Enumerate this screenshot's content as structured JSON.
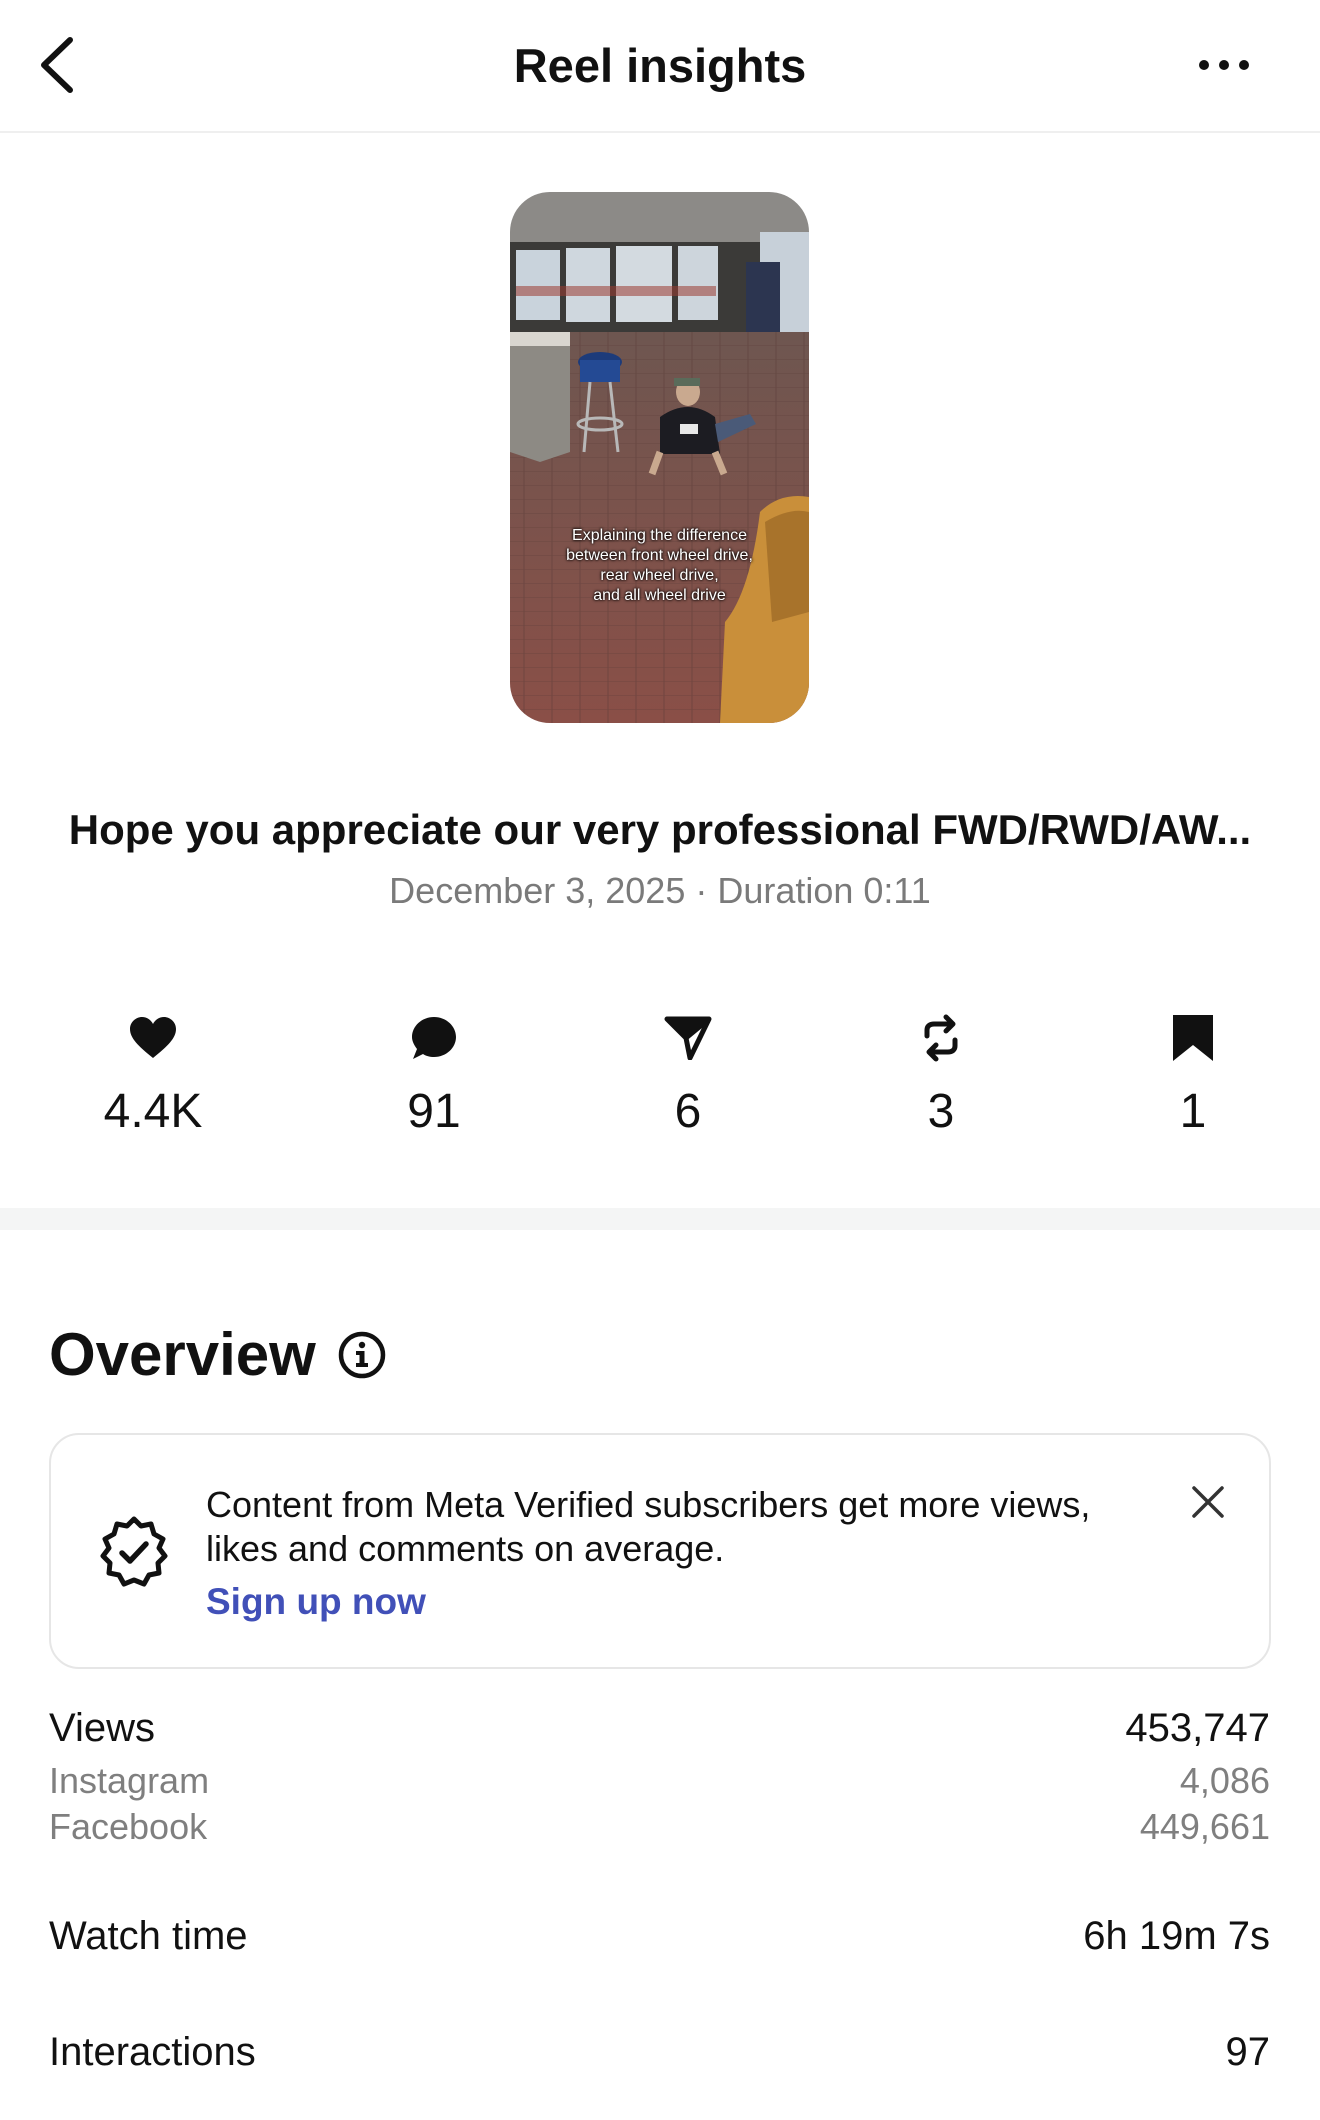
{
  "header": {
    "title": "Reel insights",
    "back_icon": "chevron-left-icon",
    "more_icon": "more-horizontal-icon"
  },
  "reel": {
    "thumbnail_caption": [
      "Explaining the difference",
      "between front wheel drive,",
      "rear wheel drive,",
      "and all wheel drive"
    ],
    "title": "Hope you appreciate our very professional FWD/RWD/AW...",
    "meta": "December 3, 2025 · Duration 0:11"
  },
  "stats": [
    {
      "icon": "heart-icon",
      "value": "4.4K"
    },
    {
      "icon": "comment-icon",
      "value": "91"
    },
    {
      "icon": "share-icon",
      "value": "6"
    },
    {
      "icon": "repost-icon",
      "value": "3"
    },
    {
      "icon": "bookmark-icon",
      "value": "1"
    }
  ],
  "overview": {
    "title": "Overview",
    "banner": {
      "text": "Content from Meta Verified subscribers get more views, likes and comments on average.",
      "link": "Sign up now"
    },
    "views": {
      "label": "Views",
      "value": "453,747",
      "breakdown": [
        {
          "label": "Instagram",
          "value": "4,086"
        },
        {
          "label": "Facebook",
          "value": "449,661"
        }
      ]
    },
    "watch_time": {
      "label": "Watch time",
      "value": "6h 19m 7s"
    },
    "interactions": {
      "label": "Interactions",
      "value": "97"
    }
  },
  "colors": {
    "link": "#4150b8",
    "muted_text": "#7a7a7a",
    "divider": "#f4f5f5"
  }
}
